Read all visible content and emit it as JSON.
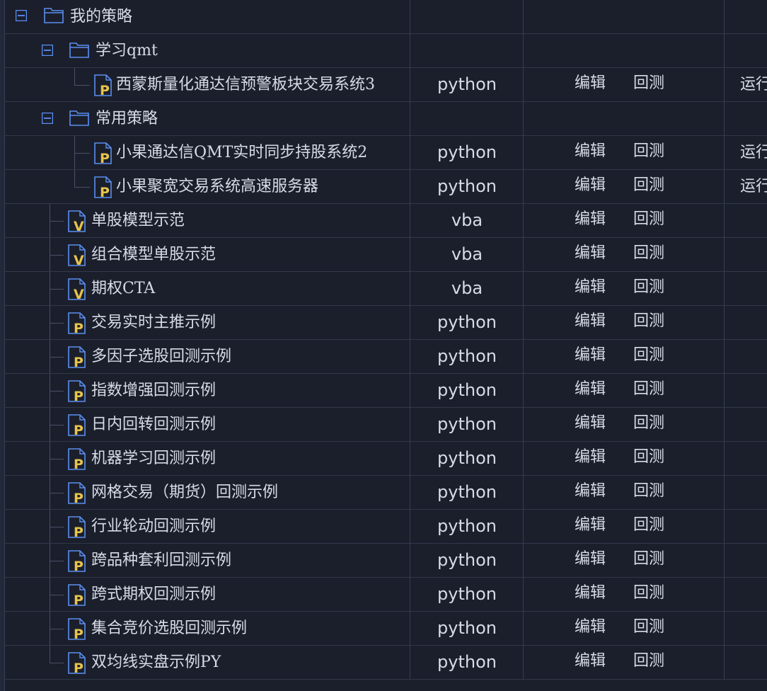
{
  "tree": {
    "root_folder": "我的策略",
    "folder_learn": "学习qmt",
    "folder_common": "常用策略",
    "rows": [
      {
        "name": "西蒙斯量化通达信预警板块交易系统3",
        "lang": "python",
        "edit": "编辑",
        "test": "回测",
        "run": "运行"
      },
      {
        "name": "小果通达信QMT实时同步持股系统2",
        "lang": "python",
        "edit": "编辑",
        "test": "回测",
        "run": "运行"
      },
      {
        "name": "小果聚宽交易系统高速服务器",
        "lang": "python",
        "edit": "编辑",
        "test": "回测",
        "run": "运行"
      },
      {
        "name": "单股模型示范",
        "lang": "vba",
        "edit": "编辑",
        "test": "回测"
      },
      {
        "name": "组合模型单股示范",
        "lang": "vba",
        "edit": "编辑",
        "test": "回测"
      },
      {
        "name": "期权CTA",
        "lang": "vba",
        "edit": "编辑",
        "test": "回测"
      },
      {
        "name": "交易实时主推示例",
        "lang": "python",
        "edit": "编辑",
        "test": "回测"
      },
      {
        "name": "多因子选股回测示例",
        "lang": "python",
        "edit": "编辑",
        "test": "回测"
      },
      {
        "name": "指数增强回测示例",
        "lang": "python",
        "edit": "编辑",
        "test": "回测"
      },
      {
        "name": "日内回转回测示例",
        "lang": "python",
        "edit": "编辑",
        "test": "回测"
      },
      {
        "name": "机器学习回测示例",
        "lang": "python",
        "edit": "编辑",
        "test": "回测"
      },
      {
        "name": "网格交易（期货）回测示例",
        "lang": "python",
        "edit": "编辑",
        "test": "回测"
      },
      {
        "name": "行业轮动回测示例",
        "lang": "python",
        "edit": "编辑",
        "test": "回测"
      },
      {
        "name": "跨品种套利回测示例",
        "lang": "python",
        "edit": "编辑",
        "test": "回测"
      },
      {
        "name": "跨式期权回测示例",
        "lang": "python",
        "edit": "编辑",
        "test": "回测"
      },
      {
        "name": "集合竞价选股回测示例",
        "lang": "python",
        "edit": "编辑",
        "test": "回测"
      },
      {
        "name": "双均线实盘示例PY",
        "lang": "python",
        "edit": "编辑",
        "test": "回测"
      }
    ]
  },
  "colors": {
    "background": "#1b1f2c",
    "text": "#d7dbe6",
    "icon_blue": "#5b8ff0",
    "icon_yellow": "#e8c44a",
    "grid_line": "#323849"
  }
}
